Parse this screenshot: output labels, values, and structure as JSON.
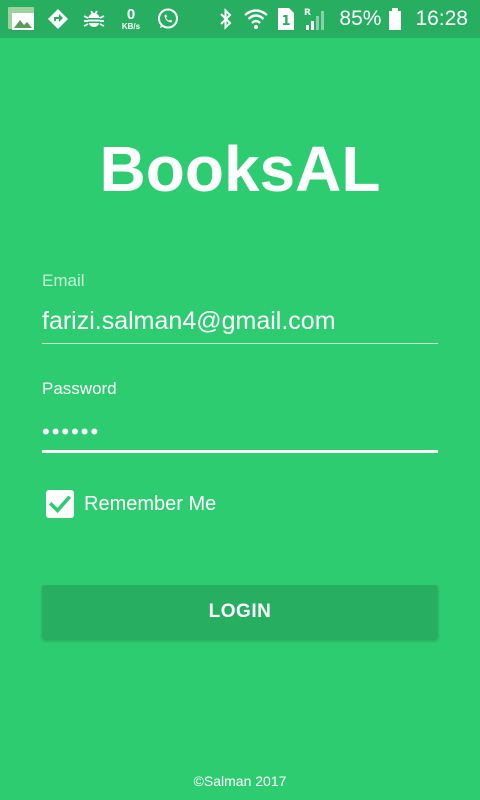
{
  "status_bar": {
    "network_speed_value": "0",
    "network_speed_unit": "KB/s",
    "sim_slot": "1",
    "roaming_indicator": "R",
    "battery": "85%",
    "time": "16:28",
    "icons": [
      "image-notification-icon",
      "navigation-icon",
      "bug-icon",
      "whatsapp-icon",
      "bluetooth-icon",
      "wifi-icon",
      "sim-icon",
      "signal-icon",
      "battery-icon"
    ]
  },
  "app": {
    "title": "BooksAL"
  },
  "form": {
    "email_label": "Email",
    "email_value": "farizi.salman4@gmail.com",
    "password_label": "Password",
    "password_value": "••••••",
    "remember_label": "Remember Me",
    "remember_checked": true,
    "login_label": "LOGIN"
  },
  "footer": {
    "text": "©Salman 2017"
  },
  "colors": {
    "background": "#2ecc71",
    "status_bar": "#27ae60",
    "button": "#27ae60",
    "text": "#ffffff"
  }
}
